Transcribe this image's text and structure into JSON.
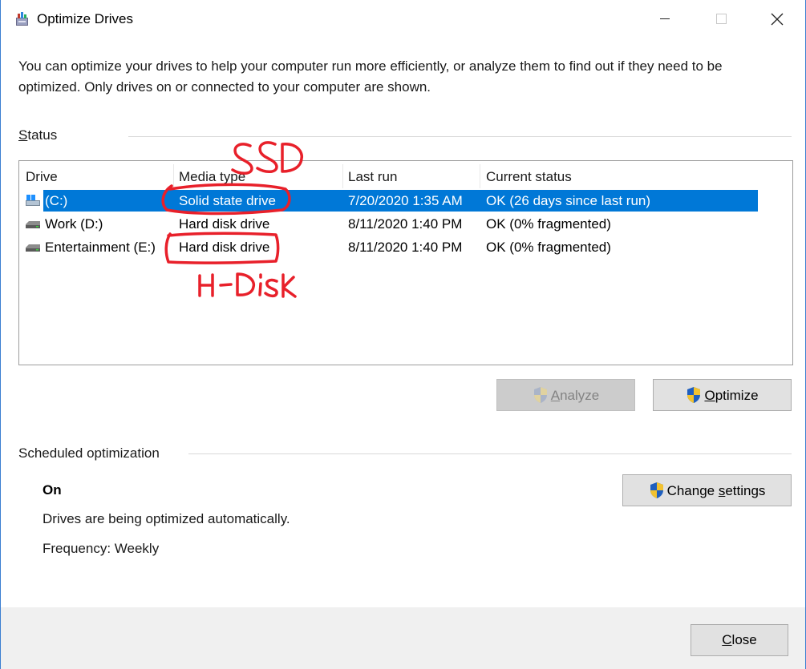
{
  "window": {
    "title": "Optimize Drives"
  },
  "intro_text": "You can optimize your drives to help your computer run more efficiently, or analyze them to find out if they need to be optimized. Only drives on or connected to your computer are shown.",
  "status_section": {
    "label": "Status",
    "columns": [
      "Drive",
      "Media type",
      "Last run",
      "Current status"
    ],
    "drives": [
      {
        "drive": "(C:)",
        "media_type": "Solid state drive",
        "last_run": "7/20/2020 1:35 AM",
        "current_status": "OK (26 days since last run)",
        "selected": true,
        "icon": "windows-drive-icon"
      },
      {
        "drive": "Work (D:)",
        "media_type": "Hard disk drive",
        "last_run": "8/11/2020 1:40 PM",
        "current_status": "OK (0% fragmented)",
        "selected": false,
        "icon": "hard-drive-icon"
      },
      {
        "drive": "Entertainment (E:)",
        "media_type": "Hard disk drive",
        "last_run": "8/11/2020 1:40 PM",
        "current_status": "OK (0% fragmented)",
        "selected": false,
        "icon": "hard-drive-icon"
      }
    ]
  },
  "buttons": {
    "analyze": {
      "first": "A",
      "rest": "nalyze",
      "enabled": false
    },
    "optimize": {
      "first": "O",
      "rest": "ptimize",
      "enabled": true
    }
  },
  "scheduled": {
    "label": "Scheduled optimization",
    "state": "On",
    "description": "Drives are being optimized automatically.",
    "frequency": "Frequency: Weekly",
    "change_button": {
      "before": "Change ",
      "underlined": "s",
      "after": "ettings"
    }
  },
  "footer": {
    "close_button": {
      "first": "C",
      "rest": "lose"
    }
  },
  "annotations": {
    "ssd_note": "SSD",
    "hdisk_note": "H-Disk",
    "ink_color": "#e8202a"
  }
}
